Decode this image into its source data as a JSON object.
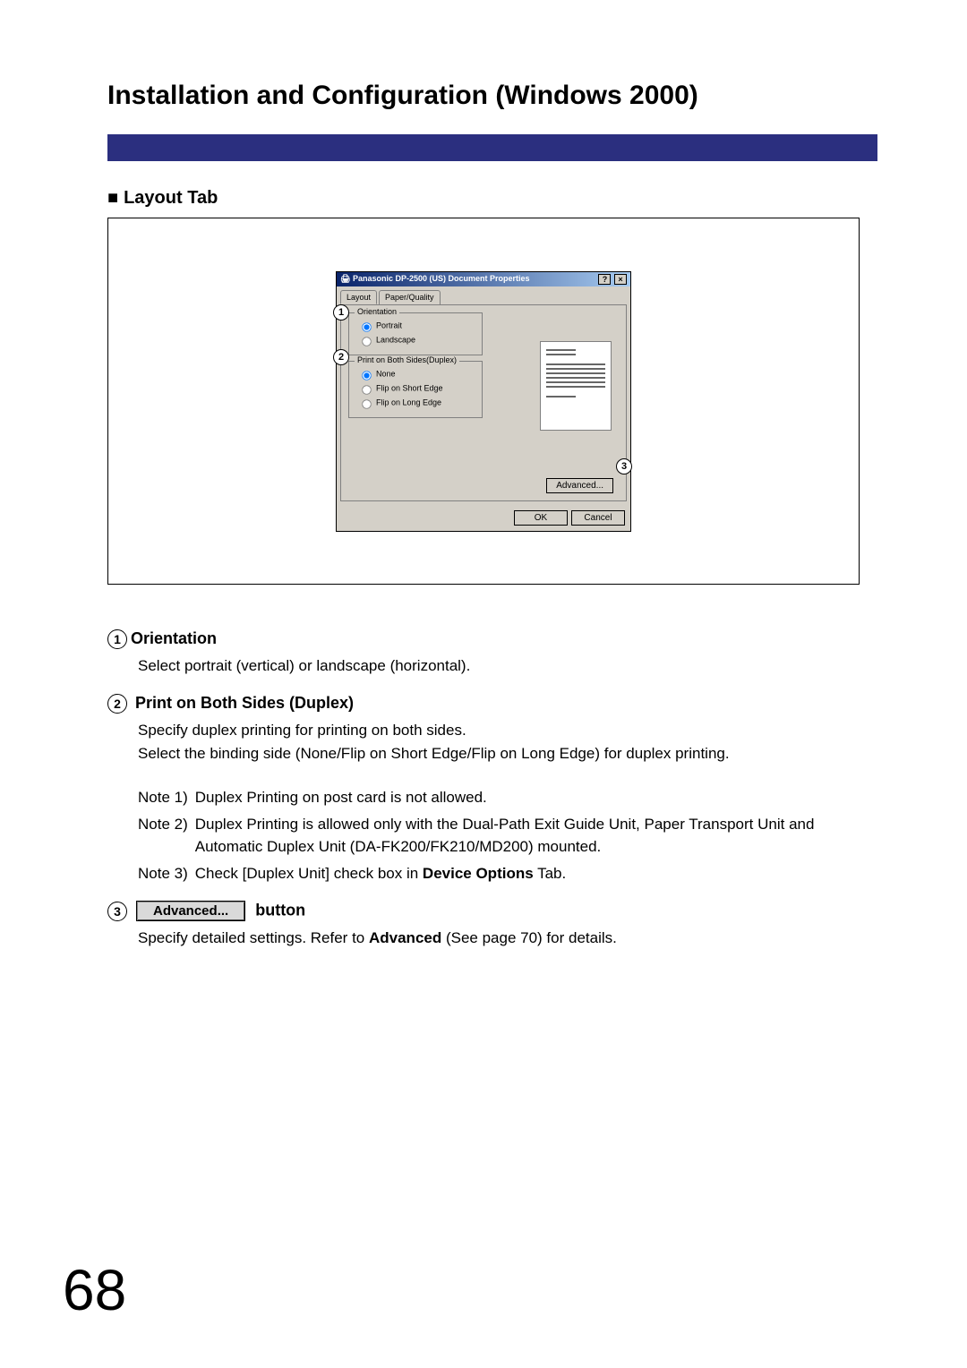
{
  "page": {
    "title": "Installation and Configuration (Windows 2000)",
    "subhead": "Layout Tab",
    "number": "68"
  },
  "dialog": {
    "title": "Panasonic DP-2500 (US) Document Properties",
    "help_icon": "?",
    "close_icon": "×",
    "tabs": {
      "layout": "Layout",
      "paper_quality": "Paper/Quality"
    },
    "orientation": {
      "legend": "Orientation",
      "portrait": "Portrait",
      "landscape": "Landscape"
    },
    "duplex": {
      "legend": "Print on Both Sides(Duplex)",
      "none": "None",
      "short": "Flip on Short Edge",
      "long": "Flip on Long Edge"
    },
    "advanced": "Advanced...",
    "ok": "OK",
    "cancel": "Cancel"
  },
  "callouts": {
    "c1": "1",
    "c2": "2",
    "c3": "3"
  },
  "sections": {
    "s1": {
      "num": "1",
      "title": "Orientation",
      "body": "Select portrait (vertical) or landscape (horizontal)."
    },
    "s2": {
      "num": "2",
      "title": " Print on Both Sides (Duplex)",
      "body1": "Specify duplex printing for printing on both sides.",
      "body2": "Select the binding side (None/Flip on Short Edge/Flip on Long Edge) for duplex printing.",
      "note1_label": "Note 1)",
      "note1_text": "Duplex Printing on post card is not allowed.",
      "note2_label": "Note 2)",
      "note2_text": "Duplex Printing is allowed only with the Dual-Path Exit Guide Unit, Paper Transport Unit and Automatic Duplex Unit (DA-FK200/FK210/MD200) mounted.",
      "note3_label": "Note 3)",
      "note3_text_a": "Check [Duplex Unit] check box in ",
      "note3_bold": "Device Options",
      "note3_text_b": " Tab."
    },
    "s3": {
      "num": "3",
      "advanced_btn": "Advanced...",
      "title_suffix": " button",
      "body_a": "Specify detailed settings.  Refer to ",
      "body_bold": "Advanced",
      "body_b": " (See page 70) for details."
    }
  }
}
